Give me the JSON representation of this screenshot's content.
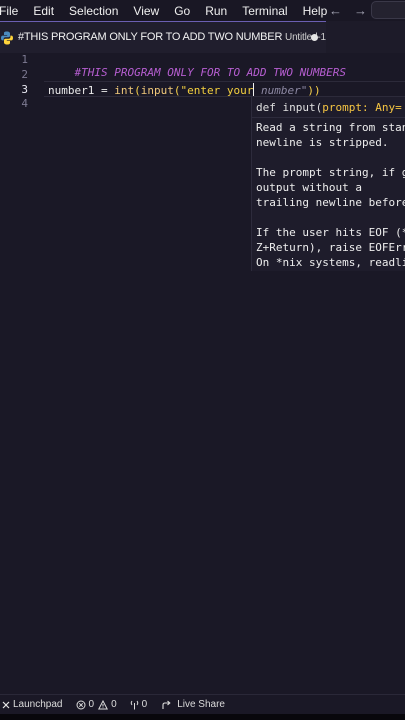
{
  "menu": {
    "items": [
      "File",
      "Edit",
      "Selection",
      "View",
      "Go",
      "Run",
      "Terminal",
      "Help"
    ]
  },
  "tab": {
    "title": "#THIS PROGRAM ONLY FOR TO ADD TWO NUMBER",
    "description": "Untitled-1",
    "icon": "python-icon",
    "modified": true
  },
  "editor": {
    "line_numbers": [
      "1",
      "2",
      "3",
      "4"
    ],
    "active_line": "3",
    "line1_comment": "#THIS PROGRAM ONLY FOR TO ADD TWO NUMBERS",
    "line3": {
      "var": "number1",
      "op": " = ",
      "fn_int": "int",
      "paren_open": "(",
      "fn_input": "input",
      "paren_open2": "(",
      "string_typed": "\"enter your",
      "ghost": " number\"",
      "paren_close": "))"
    }
  },
  "hover": {
    "signature_prefix": "def input(",
    "signature_arg": "prompt: Any=",
    "signature_rest": " .",
    "lines": [
      "Read a string from stan",
      "newline is stripped.",
      "",
      "The prompt string, if g",
      "output without a",
      "trailing newline before",
      "",
      "If the user hits EOF (*",
      "Z+Return), raise EOFErr",
      "On *nix systems, readli"
    ]
  },
  "statusbar": {
    "remote_icon": "remote-icon",
    "launchpad": "Launchpad",
    "errors": "0",
    "warnings": "0",
    "ports": "0",
    "live_share": "Live Share"
  },
  "colors": {
    "background": "#1a1826",
    "comment": "#b65ed1",
    "string": "#f4d03f",
    "tab_border": "#6b5fb2"
  }
}
